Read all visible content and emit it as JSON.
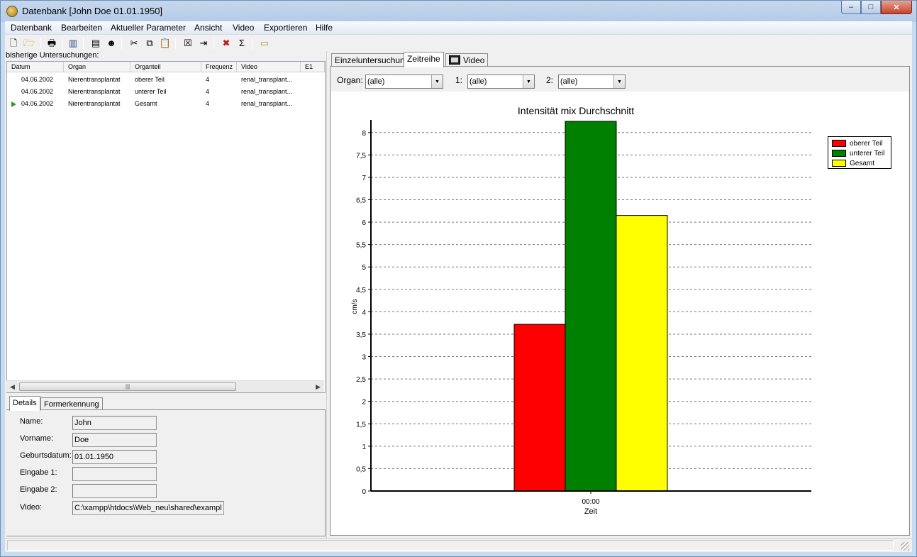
{
  "window": {
    "title": "Datenbank [John Doe 01.01.1950]",
    "buttons": {
      "minimize": "–",
      "maximize": "□",
      "close": "✕"
    }
  },
  "menu": [
    "Datenbank",
    "Bearbeiten",
    "Aktueller Parameter",
    "Ansicht",
    "Video",
    "Exportieren",
    "Hilfe"
  ],
  "toolbar": {
    "icons": [
      "new-icon",
      "open-icon",
      "print-icon",
      "database-icon",
      "id-card-icon",
      "person-icon",
      "cut-icon",
      "copy-icon",
      "paste-icon",
      "delete-icon",
      "export-icon",
      "cancel-icon",
      "sum-icon",
      "folder-icon"
    ],
    "glyphs": [
      "🗋",
      "🗁",
      "🖶",
      "▥",
      "▤",
      "☻",
      "✂",
      "⧉",
      "📋",
      "☒",
      "⇥",
      "✖",
      "Σ",
      "▭"
    ]
  },
  "left": {
    "list_label": "bisherige Untersuchungen:",
    "columns": [
      "Datum",
      "Organ",
      "Organteil",
      "Frequenz",
      "Video",
      "E1"
    ],
    "rows": [
      [
        "04.06.2002",
        "Nierentransplantat",
        "oberer Teil",
        "4",
        "renal_transplant..."
      ],
      [
        "04.06.2002",
        "Nierentransplantat",
        "unterer Teil",
        "4",
        "renal_transplant..."
      ],
      [
        "04.06.2002",
        "Nierentransplantat",
        "Gesamt",
        "4",
        "renal_transplant..."
      ]
    ],
    "scroll": {
      "left": "◀",
      "right": "▶",
      "thumb": "|||"
    },
    "detail_tabs": [
      "Details",
      "Formerkennung"
    ],
    "details": {
      "name_label": "Name:",
      "name": "John",
      "vorname_label": "Vorname:",
      "vorname": "Doe",
      "geb_label": "Geburtsdatum:",
      "geb": "01.01.1950",
      "e1_label": "Eingabe 1:",
      "e1": "",
      "e2_label": "Eingabe 2:",
      "e2": "",
      "video_label": "Video:",
      "video": "C:\\xampp\\htdocs\\Web_neu\\shared\\exampl"
    }
  },
  "right": {
    "tabs": [
      "Einzeluntersuchung",
      "Zeitreihe",
      "Video"
    ],
    "filters": {
      "organ_label": "Organ:",
      "organ": "(alle)",
      "one_label": "1:",
      "one": "(alle)",
      "two_label": "2:",
      "two": "(alle)",
      "arrow": "▼"
    }
  },
  "chart_data": {
    "type": "bar",
    "title": "Intensität mix Durchschnitt",
    "xlabel": "Zeit",
    "ylabel": "cm/s",
    "categories": [
      "00:00"
    ],
    "series": [
      {
        "name": "oberer Teil",
        "values": [
          3.72
        ],
        "color": "#ff0000"
      },
      {
        "name": "unterer Teil",
        "values": [
          8.25
        ],
        "color": "#008000"
      },
      {
        "name": "Gesamt",
        "values": [
          6.15
        ],
        "color": "#ffff00"
      }
    ],
    "ylim": [
      0,
      8.25
    ],
    "yticks": [
      "0",
      "0,5",
      "1",
      "1,5",
      "2",
      "2,5",
      "3",
      "3,5",
      "4",
      "4,5",
      "5",
      "5,5",
      "6",
      "6,5",
      "7",
      "7,5",
      "8"
    ],
    "grid": true,
    "legend_position": "top-right"
  }
}
